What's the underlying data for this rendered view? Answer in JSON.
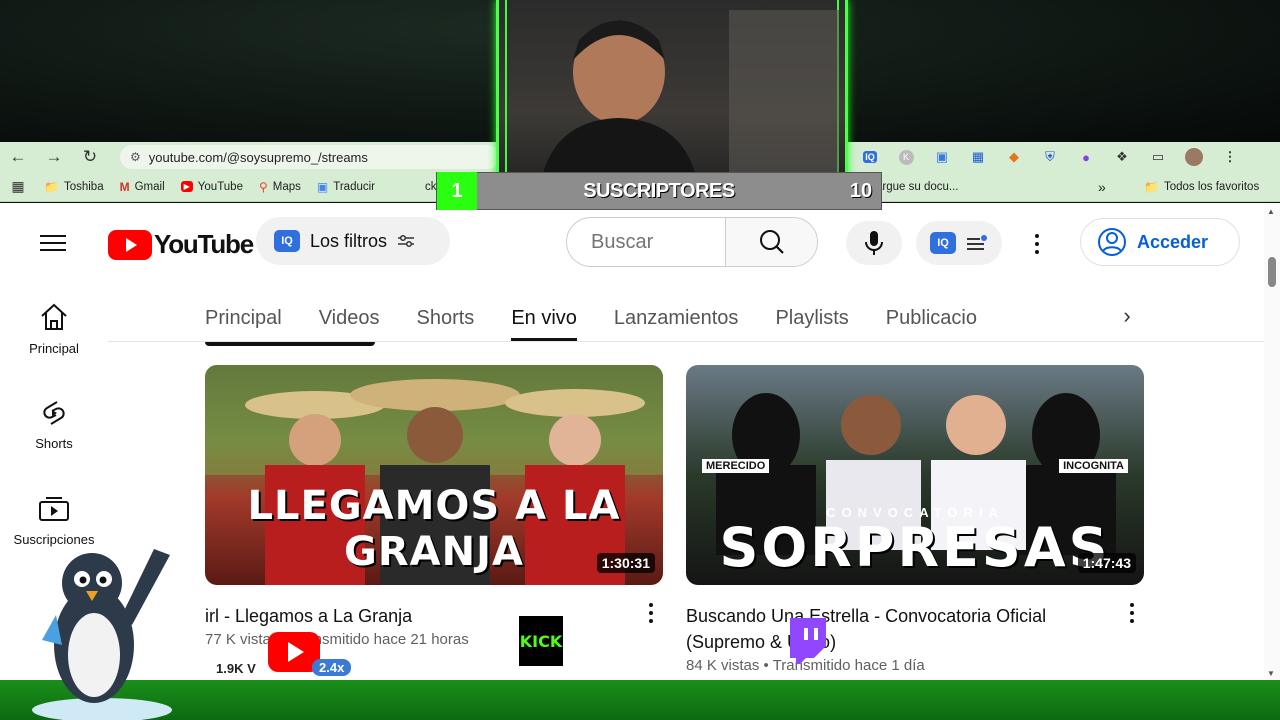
{
  "browser": {
    "url": "youtube.com/@soysupremo_/streams",
    "extension_icons": [
      "iq-icon",
      "k-icon",
      "translate-icon",
      "grid-icon",
      "metamask-icon",
      "shield-icon",
      "droplet-icon",
      "puzzle-icon",
      "cast-icon",
      "profile-avatar",
      "menu-dots-icon"
    ],
    "bookmarks": [
      {
        "label": "Toshiba",
        "icon": "folder-icon"
      },
      {
        "label": "Gmail",
        "icon": "gmail-icon"
      },
      {
        "label": "YouTube",
        "icon": "youtube-icon"
      },
      {
        "label": "Maps",
        "icon": "maps-icon"
      },
      {
        "label": "Traducir",
        "icon": "translate-icon"
      }
    ],
    "bookmark_partial": "argue su docu...",
    "bookmark_partial_left": "ck",
    "bookmarks_overflow": "»",
    "all_bookmarks": "Todos los favoritos"
  },
  "overlay": {
    "subs_left": "1",
    "subs_label": "SUSCRIPTORES",
    "subs_right": "10",
    "yt_count": "1.9K V",
    "kick_count": "2.4x",
    "kick_label": "KICK"
  },
  "masthead": {
    "logo_text": "YouTube",
    "filters_label": "Los filtros",
    "search_placeholder": "Buscar",
    "signin_label": "Acceder"
  },
  "sidebar": {
    "items": [
      {
        "label": "Principal",
        "icon": "home-icon"
      },
      {
        "label": "Shorts",
        "icon": "shorts-icon"
      },
      {
        "label": "Suscripciones",
        "icon": "subscriptions-icon"
      }
    ]
  },
  "tabs": {
    "items": [
      "Principal",
      "Videos",
      "Shorts",
      "En vivo",
      "Lanzamientos",
      "Playlists",
      "Publicacio"
    ],
    "active": "En vivo"
  },
  "videos": [
    {
      "title": "irl - Llegamos a La Granja",
      "meta": "77 K vistas • Transmitido hace 21 horas",
      "duration": "1:30:31",
      "thumb_text": "LLEGAMOS A LA GRANJA"
    },
    {
      "title": "Buscando Una Estrella - Convocatoria Oficial (Supremo & Ubão)",
      "meta": "84 K vistas • Transmitido hace 1 día",
      "duration": "1:47:43",
      "thumb_text": "SORPRESAS",
      "thumb_sub": "CONVOCATORIA",
      "thumb_label_left": "MERECIDO",
      "thumb_label_right": "INCOGNITA"
    }
  ],
  "colors": {
    "chrome_bar": "#d6ecd3",
    "yt_red": "#ff0000",
    "signin_blue": "#065fd4",
    "overlay_green": "#2aff12"
  }
}
